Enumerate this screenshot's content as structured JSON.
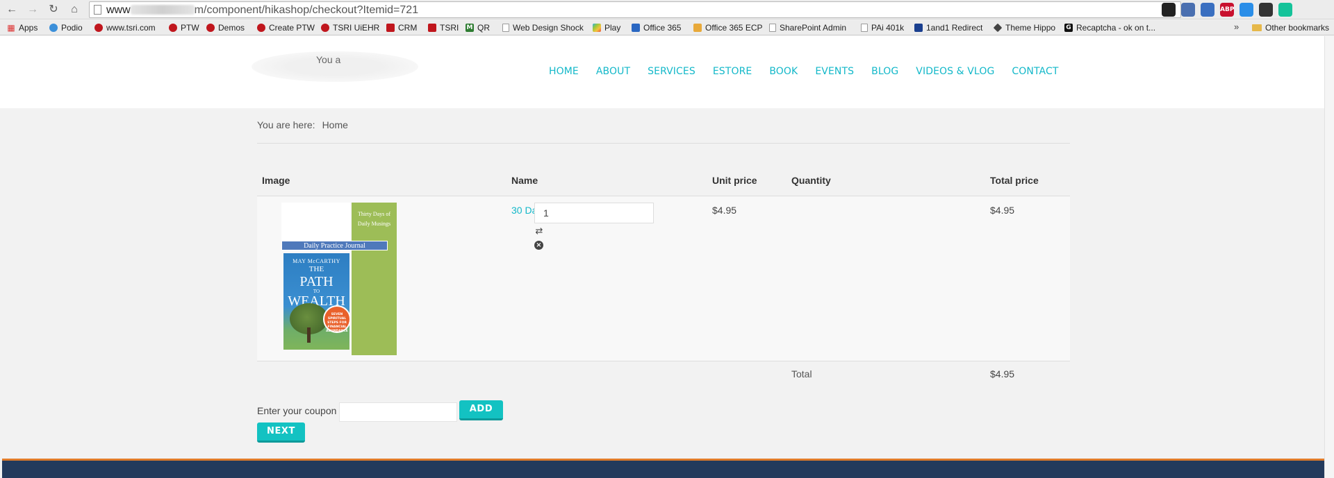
{
  "browser": {
    "url_prefix": "www",
    "url_suffix": "m/component/hikashop/checkout?Itemid=721",
    "extensions": [
      {
        "name": "owl-extension-icon",
        "label": "",
        "color": "#222222"
      },
      {
        "name": "translate-extension-icon",
        "label": "",
        "color": "#4a6fb0"
      },
      {
        "name": "camera-extension-icon",
        "label": "",
        "color": "#3a6fc0"
      },
      {
        "name": "adblock-plus-icon",
        "label": "ABP",
        "color": "#c8102e"
      },
      {
        "name": "download-extension-icon",
        "label": "",
        "color": "#2a8ee8"
      },
      {
        "name": "mask-extension-icon",
        "label": "",
        "color": "#333333"
      },
      {
        "name": "grammarly-icon",
        "label": "",
        "color": "#15c39a"
      }
    ]
  },
  "bookmarks": [
    {
      "label": "Apps",
      "icon": "apps-grid-icon"
    },
    {
      "label": "Podio",
      "icon": "podio-icon"
    },
    {
      "label": "www.tsri.com",
      "icon": "tsri-dot-icon"
    },
    {
      "label": "PTW",
      "icon": "tsri-dot-icon"
    },
    {
      "label": "Demos",
      "icon": "tsri-dot-icon"
    },
    {
      "label": "Create PTW",
      "icon": "tsri-dot-icon"
    },
    {
      "label": "TSRI UiEHR",
      "icon": "tsri-dot-icon"
    },
    {
      "label": "CRM",
      "icon": "crm-icon"
    },
    {
      "label": "TSRI",
      "icon": "crm-icon"
    },
    {
      "label": "QR",
      "icon": "qr-m-icon"
    },
    {
      "label": "Web Design Shock",
      "icon": "page-icon"
    },
    {
      "label": "Play",
      "icon": "play-store-icon"
    },
    {
      "label": "Office 365",
      "icon": "office365-icon"
    },
    {
      "label": "Office 365 ECP",
      "icon": "ecp-icon"
    },
    {
      "label": "SharePoint Admin",
      "icon": "page-icon"
    },
    {
      "label": "PAi 401k",
      "icon": "page-icon"
    },
    {
      "label": "1and1 Redirect",
      "icon": "1and1-icon"
    },
    {
      "label": "Theme Hippo",
      "icon": "tag-icon"
    },
    {
      "label": "Recaptcha - ok on t...",
      "icon": "recaptcha-icon"
    }
  ],
  "bookmarks_more": "»",
  "other_bookmarks": "Other bookmarks",
  "site": {
    "logo_text": "You a",
    "nav": [
      "HOME",
      "ABOUT",
      "SERVICES",
      "ESTORE",
      "BOOK",
      "EVENTS",
      "BLOG",
      "VIDEOS & VLOG",
      "CONTACT"
    ]
  },
  "breadcrumb": {
    "label": "You are here:",
    "items": [
      "Home"
    ]
  },
  "cart": {
    "headers": {
      "image": "Image",
      "name": "Name",
      "unit_price": "Unit price",
      "quantity": "Quantity",
      "total_price": "Total price"
    },
    "items": [
      {
        "name": "30 Day Daily Practice Journal",
        "unit_price": "$4.95",
        "quantity": "1",
        "total_price": "$4.95"
      }
    ],
    "total_label": "Total",
    "total_value": "$4.95"
  },
  "book_cover": {
    "side_text_line1": "Thirty Days of",
    "side_text_line2": "Daily Musings",
    "band_text": "Daily Practice Journal",
    "author": "MAY McCARTHY",
    "title_1": "THE",
    "title_2": "PATH",
    "title_3": "TO",
    "title_4": "WEALTH",
    "badge_lines": [
      "SEVEN",
      "SPIRITUAL",
      "STEPS FOR",
      "FINANCIAL",
      "ABUNDANCE"
    ]
  },
  "coupon": {
    "label": "Enter your coupon",
    "add_label": "ADD"
  },
  "next_label": "NEXT"
}
